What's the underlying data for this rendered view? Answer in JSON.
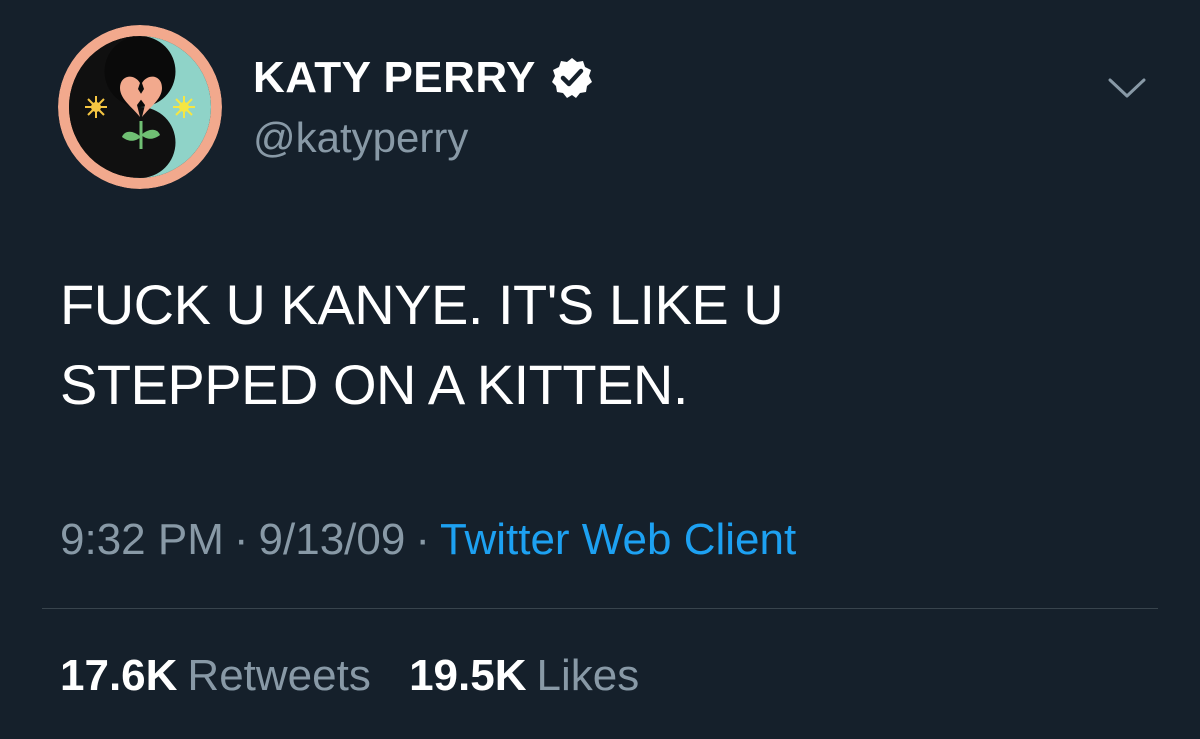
{
  "author": {
    "display_name": "KATY PERRY",
    "handle": "@katyperry",
    "verified": true
  },
  "icons": {
    "verified": "verified-badge-icon",
    "more": "chevron-down-icon"
  },
  "tweet": {
    "lines": [
      "FUCK U KANYE. IT'S LIKE U",
      "STEPPED ON A KITTEN."
    ]
  },
  "meta": {
    "time": "9:32 PM",
    "separator": "·",
    "date": "9/13/09",
    "source": "Twitter Web Client"
  },
  "stats": {
    "retweets_count": "17.6K",
    "retweets_label": "Retweets",
    "likes_count": "19.5K",
    "likes_label": "Likes"
  },
  "colors": {
    "background": "#15202b",
    "secondary_text": "#8899a6",
    "link": "#1da1f2",
    "divider": "#38444d",
    "avatar_ring": "#f2a98d",
    "avatar_teal": "#8fd3c8"
  }
}
